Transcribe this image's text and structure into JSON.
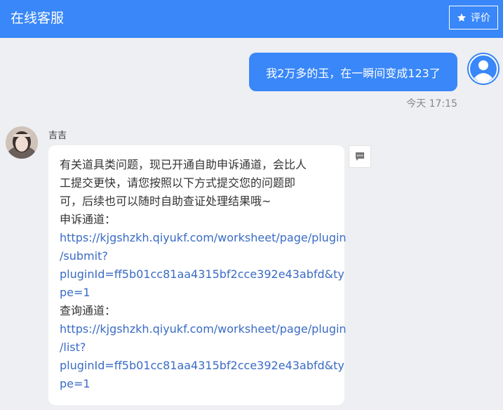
{
  "header": {
    "title": "在线客服",
    "rate_label": "评价"
  },
  "messages": {
    "user": {
      "text": "我2万多的玉，在一瞬间变成123了",
      "time": "今天 17:15"
    },
    "agent": {
      "name": "吉吉",
      "lines": {
        "l1": "有关道具类问题，现已开通自助申诉通道，会比人",
        "l2": "工提交更快，请您按照以下方式提交您的问题即",
        "l3": "可，后续也可以随时自助查证处理结果哦~",
        "appeal_label": "申诉通道：",
        "appeal_link": [
          "https://kjgshzkh.qiyukf.com/worksheet/page/plugin",
          "/submit?",
          "pluginId=ff5b01cc81aa4315bf2cce392e43abfd&ty",
          "pe=1"
        ],
        "query_label": "查询通道：",
        "query_link": [
          "https://kjgshzkh.qiyukf.com/worksheet/page/plugin",
          "/list?",
          "pluginId=ff5b01cc81aa4315bf2cce392e43abfd&ty",
          "pe=1"
        ]
      }
    }
  },
  "colors": {
    "brand": "#3987f8",
    "background": "#eeeff2",
    "link": "#3a6bc4"
  },
  "icons": {
    "rate": "star-icon",
    "user_avatar": "user-avatar-icon",
    "reply": "chat-bubble-icon"
  }
}
